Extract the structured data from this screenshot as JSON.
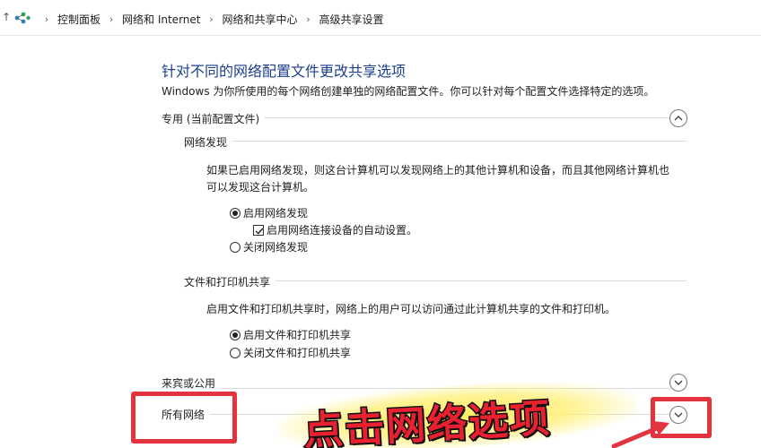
{
  "breadcrumb": [
    "控制面板",
    "网络和 Internet",
    "网络和共享中心",
    "高级共享设置"
  ],
  "title": "针对不同的网络配置文件更改共享选项",
  "intro": "Windows 为你所使用的每个网络创建单独的网络配置文件。你可以针对每个配置文件选择特定的选项。",
  "private_profile": {
    "label": "专用 (当前配置文件)",
    "network_discovery": {
      "heading": "网络发现",
      "description_line1": "如果已启用网络发现，则这台计算机可以发现网络上的其他计算机和设备，而且其他网络计算机也",
      "description_line2": "可以发现这台计算机。",
      "options": [
        {
          "label": "启用网络发现",
          "selected": true
        },
        {
          "label": "关闭网络发现",
          "selected": false
        }
      ],
      "auto_setup": {
        "label": "启用网络连接设备的自动设置。",
        "checked": true
      }
    },
    "file_printer_sharing": {
      "heading": "文件和打印机共享",
      "description": "启用文件和打印机共享时，网络上的用户可以访问通过此计算机共享的文件和打印机。",
      "options": [
        {
          "label": "启用文件和打印机共享",
          "selected": true
        },
        {
          "label": "关闭文件和打印机共享",
          "selected": false
        }
      ]
    }
  },
  "guest_profile": {
    "label": "来宾或公用"
  },
  "all_networks": {
    "label": "所有网络"
  },
  "annotation": {
    "banner": "点击网络选项"
  },
  "colors": {
    "title": "#1c3f8f",
    "highlight": "#e2333f",
    "banner_text": "#e8202f",
    "banner_glow": "#ffec5a"
  }
}
